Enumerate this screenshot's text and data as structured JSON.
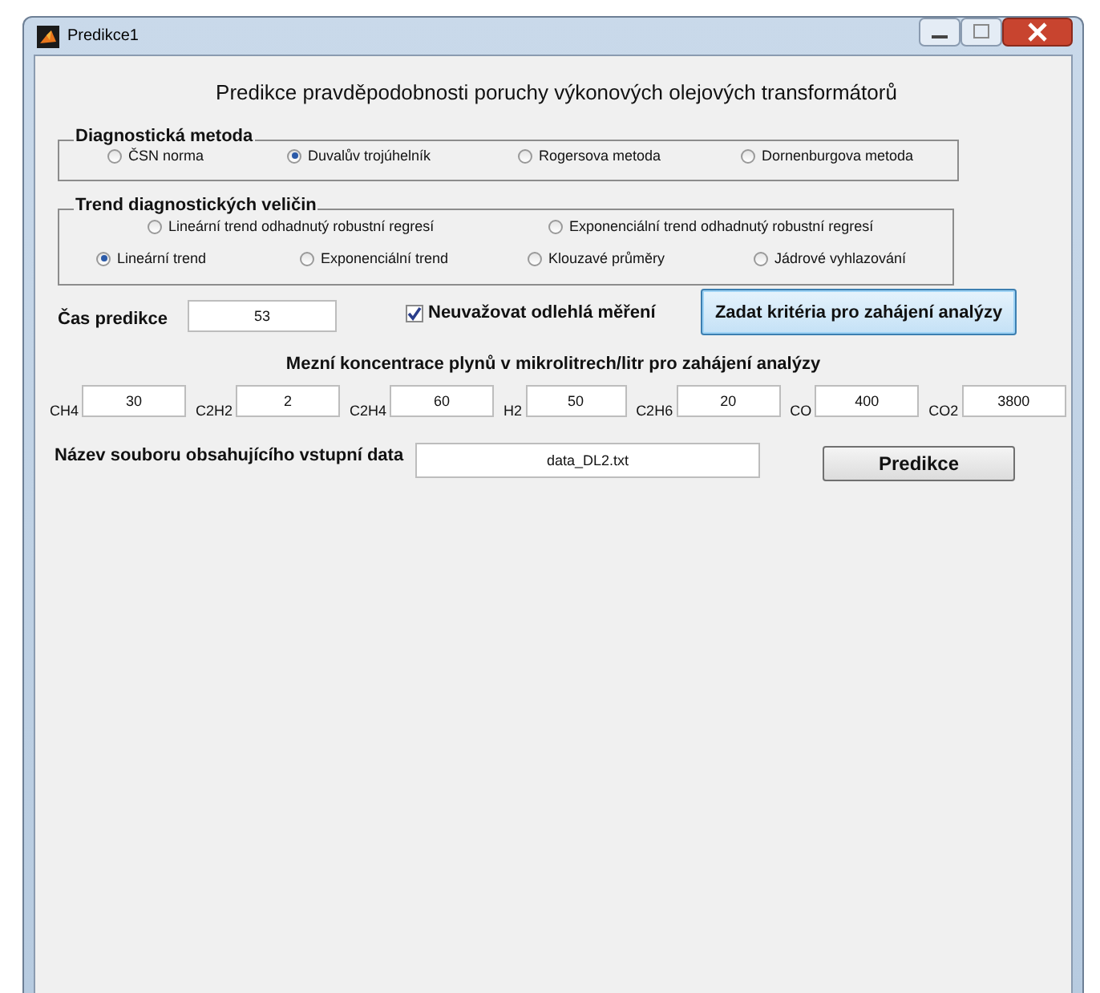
{
  "window": {
    "title": "Predikce1"
  },
  "heading": "Predikce pravděpodobnosti poruchy výkonových olejových transformátorů",
  "diagnostic_method": {
    "legend": "Diagnostická metoda",
    "options": [
      {
        "label": "ČSN norma",
        "selected": false
      },
      {
        "label": "Duvalův trojúhelník",
        "selected": true
      },
      {
        "label": "Rogersova metoda",
        "selected": false
      },
      {
        "label": "Dornenburgova metoda",
        "selected": false
      }
    ]
  },
  "trend": {
    "legend": "Trend diagnostických veličin",
    "rows": [
      {
        "options": [
          {
            "label": "Lineární trend odhadnutý robustní regresí",
            "selected": false
          },
          {
            "label": "Exponenciální trend odhadnutý robustní regresí",
            "selected": false
          }
        ]
      },
      {
        "options": [
          {
            "label": "Lineární trend",
            "selected": true
          },
          {
            "label": "Exponenciální trend",
            "selected": false
          },
          {
            "label": "Klouzavé průměry",
            "selected": false
          },
          {
            "label": "Jádrové vyhlazování",
            "selected": false
          }
        ]
      }
    ]
  },
  "prediction_time": {
    "label": "Čas predikce",
    "value": "53"
  },
  "outliers": {
    "label": "Neuvažovat odlehlá měření",
    "checked": true
  },
  "criteria_button": "Zadat kritéria pro zahájení analýzy",
  "gases": {
    "heading": "Mezní koncentrace plynů v mikrolitrech/litr pro zahájení analýzy",
    "items": [
      {
        "label": "CH4",
        "value": "30"
      },
      {
        "label": "C2H2",
        "value": "2"
      },
      {
        "label": "C2H4",
        "value": "60"
      },
      {
        "label": "H2",
        "value": "50"
      },
      {
        "label": "C2H6",
        "value": "20"
      },
      {
        "label": "CO",
        "value": "400"
      },
      {
        "label": "CO2",
        "value": "3800"
      }
    ]
  },
  "file": {
    "label": "Název souboru obsahujícího vstupní data",
    "value": "data_DL2.txt"
  },
  "predict_button": "Predikce"
}
